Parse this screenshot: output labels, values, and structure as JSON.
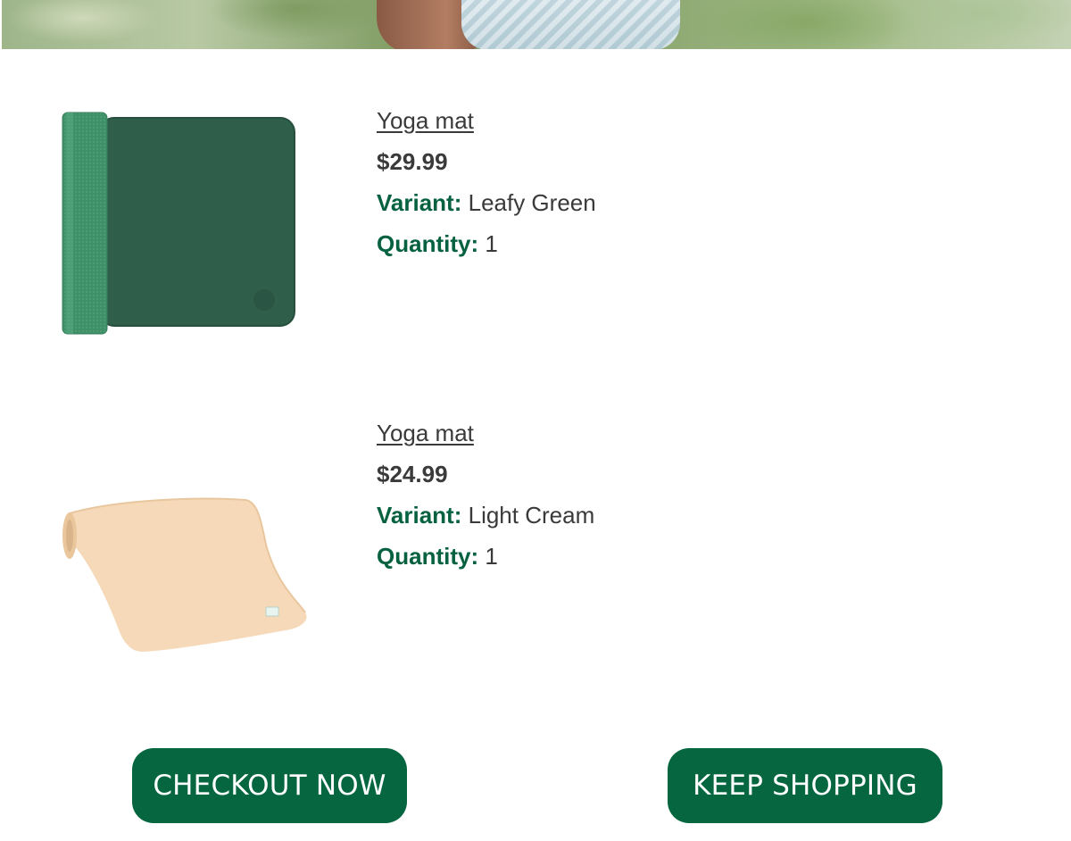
{
  "products": [
    {
      "name": "Yoga mat",
      "price": "$29.99",
      "variant_label": "Variant:",
      "variant_value": "Leafy Green",
      "quantity_label": "Quantity:",
      "quantity_value": "1",
      "image_icon": "green-rolled-yoga-mat",
      "color": "#2f5e4a"
    },
    {
      "name": "Yoga mat",
      "price": "$24.99",
      "variant_label": "Variant:",
      "variant_value": "Light Cream",
      "quantity_label": "Quantity:",
      "quantity_value": "1",
      "image_icon": "cream-rolled-yoga-mat",
      "color": "#f2d3b0"
    }
  ],
  "buttons": {
    "checkout": "CHECKOUT NOW",
    "keep_shopping": "KEEP SHOPPING"
  },
  "colors": {
    "accent": "#05663f",
    "label_green": "#05613f",
    "text": "#3a3a3a"
  }
}
